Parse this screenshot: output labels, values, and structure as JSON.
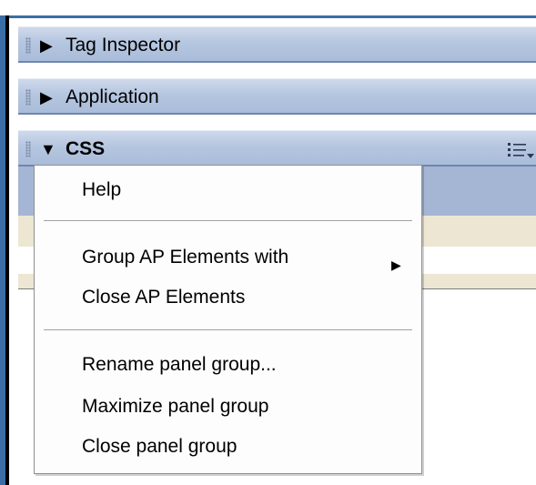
{
  "panels": [
    {
      "title": "Tag Inspector",
      "state": "collapsed"
    },
    {
      "title": "Application",
      "state": "collapsed"
    },
    {
      "title": "CSS",
      "state": "expanded"
    }
  ],
  "icons": {
    "collapsed": "triangle-right-icon",
    "expanded": "triangle-down-icon",
    "options": "panel-options-menu-icon",
    "grip": "gripper-icon",
    "submenu": "submenu-arrow-icon"
  },
  "context_menu": {
    "items": [
      {
        "label": "Help"
      },
      {
        "label": "Group AP Elements with",
        "has_submenu": true
      },
      {
        "label": "Close AP Elements"
      },
      {
        "label": "Rename panel group..."
      },
      {
        "label": "Maximize panel group"
      },
      {
        "label": "Close panel group"
      }
    ]
  },
  "colors": {
    "frame_blue": "#3a6ea5",
    "header_blue": "#b5c6e0",
    "selected_band": "#a4b6d3",
    "beige_band": "#ece6d3"
  }
}
